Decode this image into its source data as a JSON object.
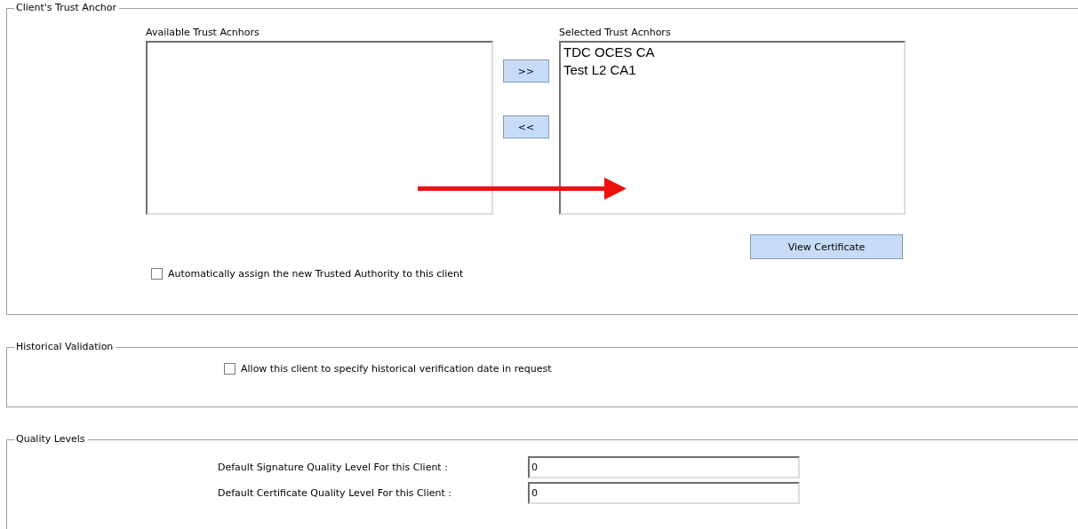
{
  "trust_anchor": {
    "legend": "Client's Trust Anchor",
    "available": {
      "label": "Available Trust Acnhors"
    },
    "move_buttons": [
      ">>",
      "<<"
    ],
    "selected": {
      "label": "Selected Trust Acnhors",
      "items": [
        {
          "text": "TDC OCES CA",
          "selected": false
        },
        {
          "text": "Test L2 CA1",
          "selected": false
        }
      ]
    },
    "view_button": "View Certificate",
    "auto_assign": {
      "label": "Automatically assign the new Trusted Authority to this client",
      "checked": false
    }
  },
  "historical_validation": {
    "legend": "Historical Validation",
    "allow": {
      "label": "Allow this client to specify historical verification date in request",
      "checked": false
    }
  },
  "quality_levels": {
    "legend": "Quality Levels",
    "fields": [
      {
        "label": "Default Signature Quality Level For this Client :",
        "value": "0"
      },
      {
        "label": "Default Certificate Quality Level For this Client :",
        "value": "0"
      }
    ]
  }
}
